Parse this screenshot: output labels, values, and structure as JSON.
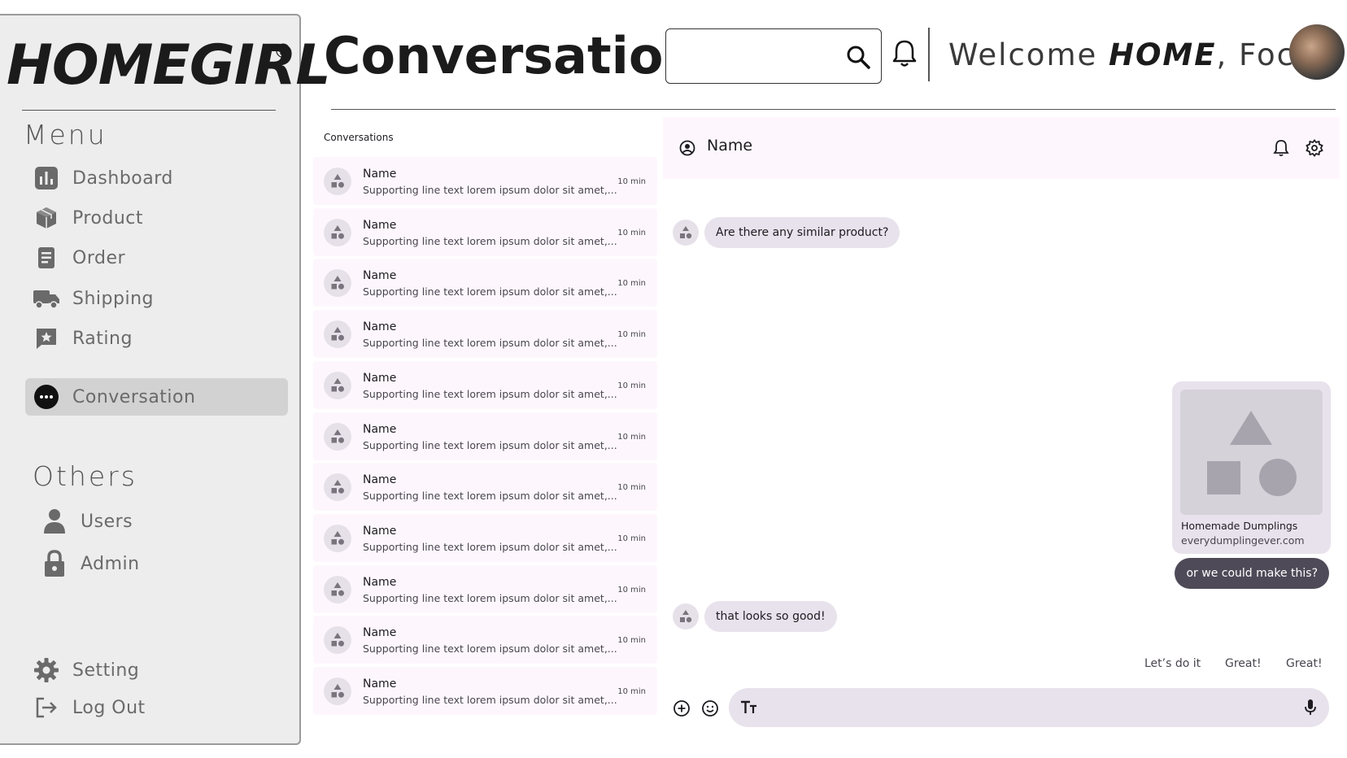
{
  "sidebar": {
    "logo": "HOMEGIRL",
    "logo_mark": "®",
    "menu_title": "Menu",
    "menu": [
      {
        "label": "Dashboard",
        "icon": "dashboard-icon"
      },
      {
        "label": "Product",
        "icon": "product-box-icon"
      },
      {
        "label": "Order",
        "icon": "order-document-icon"
      },
      {
        "label": "Shipping",
        "icon": "truck-icon"
      },
      {
        "label": "Rating",
        "icon": "star-icon"
      },
      {
        "label": "Conversation",
        "icon": "chat-bubble-icon",
        "active": true
      }
    ],
    "others_title": "Others",
    "others": [
      {
        "label": "Users",
        "icon": "user-icon"
      },
      {
        "label": "Admin",
        "icon": "lock-icon"
      }
    ],
    "footer": [
      {
        "label": "Setting",
        "icon": "gear-icon"
      },
      {
        "label": "Log Out",
        "icon": "logout-icon"
      }
    ]
  },
  "header": {
    "title": "Conversation",
    "search_placeholder": "",
    "welcome_prefix": "Welcome",
    "welcome_bold": "HOME",
    "welcome_suffix": ", Focus"
  },
  "conversations": {
    "title": "Conversations",
    "items": [
      {
        "name": "Name",
        "preview": "Supporting line text lorem ipsum dolor sit amet,...",
        "time": "10 min"
      },
      {
        "name": "Name",
        "preview": "Supporting line text lorem ipsum dolor sit amet,...",
        "time": "10 min"
      },
      {
        "name": "Name",
        "preview": "Supporting line text lorem ipsum dolor sit amet,...",
        "time": "10 min"
      },
      {
        "name": "Name",
        "preview": "Supporting line text lorem ipsum dolor sit amet,...",
        "time": "10 min"
      },
      {
        "name": "Name",
        "preview": "Supporting line text lorem ipsum dolor sit amet,...",
        "time": "10 min"
      },
      {
        "name": "Name",
        "preview": "Supporting line text lorem ipsum dolor sit amet,...",
        "time": "10 min"
      },
      {
        "name": "Name",
        "preview": "Supporting line text lorem ipsum dolor sit amet,...",
        "time": "10 min"
      },
      {
        "name": "Name",
        "preview": "Supporting line text lorem ipsum dolor sit amet,...",
        "time": "10 min"
      },
      {
        "name": "Name",
        "preview": "Supporting line text lorem ipsum dolor sit amet,...",
        "time": "10 min"
      },
      {
        "name": "Name",
        "preview": "Supporting line text lorem ipsum dolor sit amet,...",
        "time": "10 min"
      },
      {
        "name": "Name",
        "preview": "Supporting line text lorem ipsum dolor sit amet,...",
        "time": "10 min"
      }
    ]
  },
  "chat": {
    "contact_name": "Name",
    "messages": {
      "incoming_1": "Are there any similar product?",
      "link_title": "Homemade Dumplings",
      "link_url": "everydumplingever.com",
      "outgoing_1": "or we could make this?",
      "incoming_2": "that looks so good!"
    },
    "suggestions": [
      "Let’s do it",
      "Great!",
      "Great!"
    ],
    "composer_placeholder": ""
  },
  "colors": {
    "sidebar_bg": "#ededed",
    "active_item": "#d2d2d2",
    "surface": "#fdf7fd",
    "bubble_in": "#e8e2ec",
    "bubble_out": "#4f4a58"
  }
}
